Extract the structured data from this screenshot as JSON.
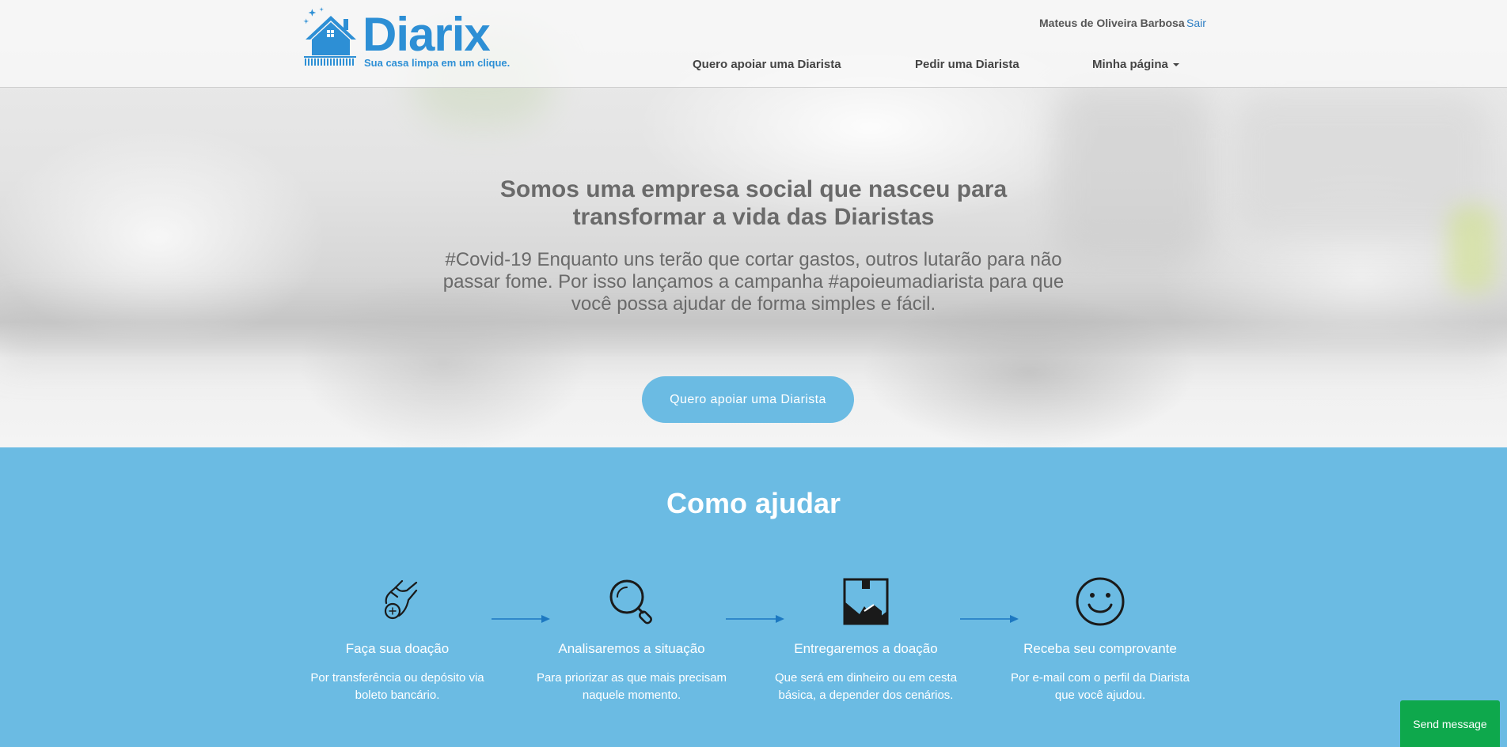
{
  "header": {
    "brand": "Diarix",
    "tagline": "Sua casa limpa em um clique.",
    "user_name": "Mateus de Oliveira Barbosa",
    "logout_label": "Sair",
    "nav": [
      {
        "label": "Quero apoiar uma Diarista"
      },
      {
        "label": "Pedir uma Diarista"
      },
      {
        "label": "Minha página"
      }
    ]
  },
  "hero": {
    "title": "Somos uma empresa social que nasceu para transformar a vida das Diaristas",
    "subtitle": "#Covid-19 Enquanto uns terão que cortar gastos, outros lutarão para não passar fome. Por isso lançamos a campanha #apoieumadiarista para que você possa ajudar de forma simples e fácil.",
    "cta_label": "Quero apoiar uma Diarista"
  },
  "how_to_help": {
    "title": "Como ajudar",
    "steps": [
      {
        "icon": "donation-hand-coin-icon",
        "title": "Faça sua doação",
        "desc": "Por transferência ou depósito via boleto bancário."
      },
      {
        "icon": "magnifier-icon",
        "title": "Analisaremos a situação",
        "desc": "Para priorizar as que mais precisam naquele momento."
      },
      {
        "icon": "package-delivery-icon",
        "title": "Entregaremos a doação",
        "desc": "Que será em dinheiro ou em cesta básica, a depender dos cenários."
      },
      {
        "icon": "smiley-face-icon",
        "title": "Receba seu comprovante",
        "desc": "Por e-mail com o perfil da Diarista que você ajudou."
      }
    ]
  },
  "chat": {
    "label": "Send message"
  },
  "colors": {
    "brand": "#2d8fd5",
    "section_bg": "#6bbbe3",
    "chat_button": "#0ea84c"
  }
}
